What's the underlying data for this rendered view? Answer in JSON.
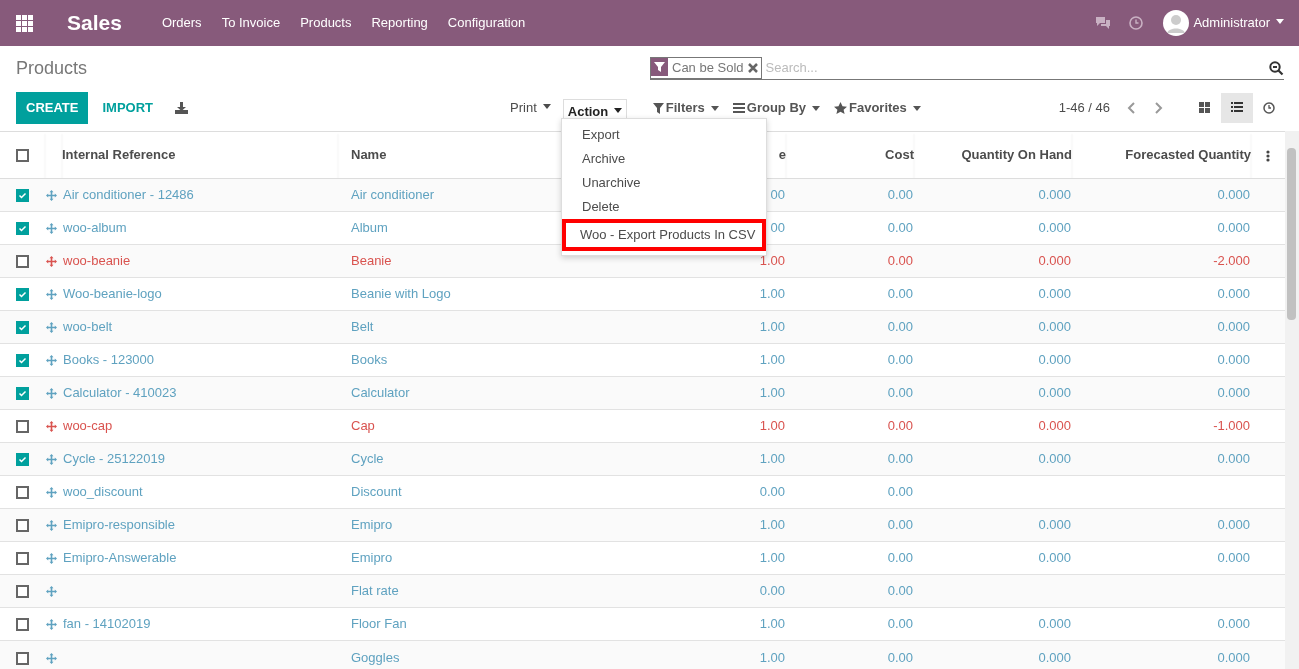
{
  "navbar": {
    "app": "Sales",
    "menu": [
      "Orders",
      "To Invoice",
      "Products",
      "Reporting",
      "Configuration"
    ],
    "user": "Administrator"
  },
  "control_panel": {
    "title": "Products",
    "buttons": [
      "CREATE",
      "IMPORT"
    ],
    "print": "Print",
    "action": "Action",
    "facet": "Can be Sold",
    "search_placeholder": "Search...",
    "filters": "Filters",
    "group_by": "Group By",
    "favorites": "Favorites",
    "pager": "1-46 / 46",
    "views": [
      {
        "kind": "kanban",
        "selected": false
      },
      {
        "kind": "list",
        "selected": true
      },
      {
        "kind": "activity",
        "selected": false
      }
    ]
  },
  "action_menu": {
    "items": [
      {
        "label": "Export",
        "highlighted": false
      },
      {
        "label": "Archive",
        "highlighted": false
      },
      {
        "label": "Unarchive",
        "highlighted": false
      },
      {
        "label": "Delete",
        "highlighted": false
      },
      {
        "label": "Woo - Export Products In CSV",
        "highlighted": true
      }
    ]
  },
  "table": {
    "columns": [
      "Internal Reference",
      "Name",
      "e",
      "Cost",
      "Quantity On Hand",
      "Forecasted Quantity"
    ],
    "select_all": false,
    "rows": [
      {
        "checked": true,
        "alert": false,
        "cells": [
          "Air conditioner - 12486",
          "Air conditioner",
          "00",
          "0.00",
          "0.000",
          "0.000"
        ]
      },
      {
        "checked": true,
        "alert": false,
        "cells": [
          "woo-album",
          "Album",
          "00",
          "0.00",
          "0.000",
          "0.000"
        ]
      },
      {
        "checked": false,
        "alert": true,
        "cells": [
          "woo-beanie",
          "Beanie",
          "1.00",
          "0.00",
          "0.000",
          "-2.000"
        ]
      },
      {
        "checked": true,
        "alert": false,
        "cells": [
          "Woo-beanie-logo",
          "Beanie with Logo",
          "1.00",
          "0.00",
          "0.000",
          "0.000"
        ]
      },
      {
        "checked": true,
        "alert": false,
        "cells": [
          "woo-belt",
          "Belt",
          "1.00",
          "0.00",
          "0.000",
          "0.000"
        ]
      },
      {
        "checked": true,
        "alert": false,
        "cells": [
          "Books - 123000",
          "Books",
          "1.00",
          "0.00",
          "0.000",
          "0.000"
        ]
      },
      {
        "checked": true,
        "alert": false,
        "cells": [
          "Calculator - 410023",
          "Calculator",
          "1.00",
          "0.00",
          "0.000",
          "0.000"
        ]
      },
      {
        "checked": false,
        "alert": true,
        "cells": [
          "woo-cap",
          "Cap",
          "1.00",
          "0.00",
          "0.000",
          "-1.000"
        ]
      },
      {
        "checked": true,
        "alert": false,
        "cells": [
          "Cycle - 25122019",
          "Cycle",
          "1.00",
          "0.00",
          "0.000",
          "0.000"
        ]
      },
      {
        "checked": false,
        "alert": false,
        "cells": [
          "woo_discount",
          "Discount",
          "0.00",
          "0.00",
          "",
          ""
        ]
      },
      {
        "checked": false,
        "alert": false,
        "cells": [
          "Emipro-responsible",
          "Emipro",
          "1.00",
          "0.00",
          "0.000",
          "0.000"
        ]
      },
      {
        "checked": false,
        "alert": false,
        "cells": [
          "Emipro-Answerable",
          "Emipro",
          "1.00",
          "0.00",
          "0.000",
          "0.000"
        ]
      },
      {
        "checked": false,
        "alert": false,
        "cells": [
          "",
          "Flat rate",
          "0.00",
          "0.00",
          "",
          ""
        ]
      },
      {
        "checked": false,
        "alert": false,
        "cells": [
          "fan - 14102019",
          "Floor Fan",
          "1.00",
          "0.00",
          "0.000",
          "0.000"
        ]
      },
      {
        "checked": false,
        "alert": false,
        "cells": [
          "",
          "Goggles",
          "1.00",
          "0.00",
          "0.000",
          "0.000"
        ]
      }
    ]
  }
}
